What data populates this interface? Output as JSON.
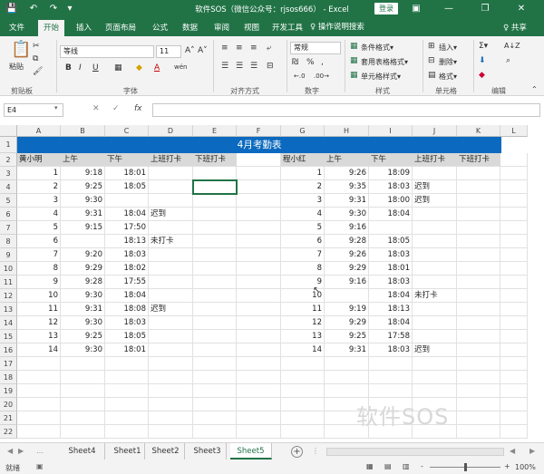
{
  "title_bar": {
    "title": "软件SOS（微信公众号：rjsos666） - Excel",
    "login_label": "登录",
    "save_glyph": "💾",
    "undo_glyph": "↶",
    "redo_glyph": "↷",
    "customize_glyph": "▾",
    "options_glyph": "▣",
    "minimize_glyph": "—",
    "restore_glyph": "❐",
    "close_glyph": "✕"
  },
  "ribbon_tabs": [
    "文件",
    "开始",
    "插入",
    "页面布局",
    "公式",
    "数据",
    "审阅",
    "视图",
    "开发工具"
  ],
  "tell_me": "♀ 操作说明搜索",
  "share": "♀ 共享",
  "ribbon": {
    "clipboard": {
      "paste": "粘贴",
      "label": "剪贴板"
    },
    "font": {
      "name": "等线",
      "size": "11",
      "grow": "A˄",
      "shrink": "A˅",
      "bold": "B",
      "italic": "I",
      "underline": "U",
      "label": "字体",
      "font_color": "A",
      "fill": "◆",
      "border": "▦",
      "wen": "wén"
    },
    "alignment": {
      "label": "对齐方式"
    },
    "number": {
      "format": "常规",
      "percent": "%",
      "comma": ",",
      "label": "数字"
    },
    "styles": {
      "cond": "条件格式▾",
      "table": "套用表格格式▾",
      "cell": "单元格样式▾",
      "label": "样式"
    },
    "cells": {
      "insert": "插入▾",
      "delete": "删除▾",
      "format": "格式▾",
      "label": "单元格"
    },
    "editing": {
      "sum": "Σ▾",
      "sort": "A↓Z",
      "find": "⌕",
      "label": "编辑"
    }
  },
  "formula_bar": {
    "name_box": "E4",
    "cancel": "✕",
    "enter": "✓",
    "fx": "fx",
    "value": ""
  },
  "columns": [
    "A",
    "B",
    "C",
    "D",
    "E",
    "F",
    "G",
    "H",
    "I",
    "J",
    "K",
    "L"
  ],
  "rows": [
    "1",
    "2",
    "3",
    "4",
    "5",
    "6",
    "7",
    "8",
    "9",
    "10",
    "11",
    "12",
    "13",
    "14",
    "15",
    "16",
    "17",
    "18",
    "19",
    "20",
    "21",
    "22"
  ],
  "sheet": {
    "title": "4月考勤表",
    "left": {
      "headers": [
        "黄小明",
        "上午",
        "下午",
        "上班打卡",
        "下班打卡"
      ],
      "rows": [
        [
          "1",
          "9:18",
          "18:01",
          ""
        ],
        [
          "2",
          "9:25",
          "18:05",
          ""
        ],
        [
          "3",
          "9:30",
          "",
          ""
        ],
        [
          "4",
          "9:31",
          "18:04",
          "迟到"
        ],
        [
          "5",
          "9:15",
          "17:50",
          ""
        ],
        [
          "6",
          "",
          "18:13",
          "未打卡"
        ],
        [
          "7",
          "9:20",
          "18:03",
          ""
        ],
        [
          "8",
          "9:29",
          "18:02",
          ""
        ],
        [
          "9",
          "9:28",
          "17:55",
          ""
        ],
        [
          "10",
          "9:30",
          "18:04",
          ""
        ],
        [
          "11",
          "9:31",
          "18:08",
          "迟到"
        ],
        [
          "12",
          "9:30",
          "18:03",
          ""
        ],
        [
          "13",
          "9:25",
          "18:05",
          ""
        ],
        [
          "14",
          "9:30",
          "18:01",
          ""
        ]
      ]
    },
    "right": {
      "headers": [
        "程小红",
        "上午",
        "下午",
        "上班打卡",
        "下班打卡"
      ],
      "rows": [
        [
          "1",
          "9:26",
          "18:09",
          ""
        ],
        [
          "2",
          "9:35",
          "18:03",
          "迟到"
        ],
        [
          "3",
          "9:31",
          "18:00",
          "迟到"
        ],
        [
          "4",
          "9:30",
          "18:04",
          ""
        ],
        [
          "5",
          "9:16",
          "",
          ""
        ],
        [
          "6",
          "9:28",
          "18:05",
          ""
        ],
        [
          "7",
          "9:26",
          "18:03",
          ""
        ],
        [
          "8",
          "9:29",
          "18:01",
          ""
        ],
        [
          "9",
          "9:16",
          "18:03",
          ""
        ],
        [
          "10",
          "",
          "18:04",
          "未打卡"
        ],
        [
          "11",
          "9:19",
          "18:13",
          ""
        ],
        [
          "12",
          "9:29",
          "18:04",
          ""
        ],
        [
          "13",
          "9:25",
          "17:58",
          ""
        ],
        [
          "14",
          "9:31",
          "18:03",
          "迟到"
        ]
      ]
    }
  },
  "watermark": "软件SOS",
  "sheet_tabs": [
    "Sheet4",
    "Sheet1",
    "Sheet2",
    "Sheet3",
    "Sheet5"
  ],
  "active_sheet": "Sheet5",
  "status": {
    "ready": "就绪",
    "zoom": "100%",
    "zoom_minus": "-",
    "zoom_plus": "+"
  },
  "colors": {
    "excel_green": "#217346",
    "title_blue": "#0b6abf"
  }
}
